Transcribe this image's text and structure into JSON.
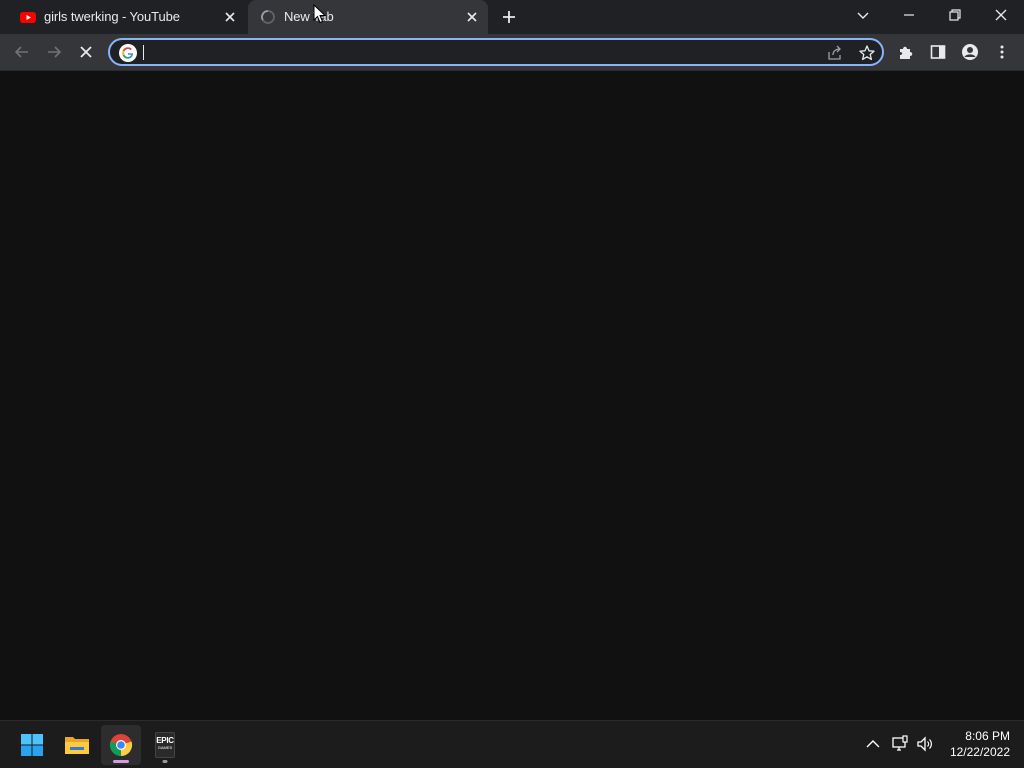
{
  "tabs": [
    {
      "title": "girls twerking - YouTube",
      "favicon": "youtube-icon",
      "active": false
    },
    {
      "title": "New Tab",
      "favicon": "loading-spinner-icon",
      "active": true
    }
  ],
  "toolbar": {
    "omnibox_value": ""
  },
  "taskbar": {
    "apps": [
      "start-button",
      "file-explorer",
      "google-chrome",
      "epic-games-launcher"
    ],
    "epic_label_top": "EPIC",
    "epic_label_bottom": "GAMES"
  },
  "clock": {
    "time": "8:06 PM",
    "date": "12/22/2022"
  },
  "colors": {
    "accent": "#8ab4f8",
    "youtube_red": "#ff0000",
    "frame": "#202124",
    "toolbar": "#35363a",
    "page_bg": "#111111"
  }
}
